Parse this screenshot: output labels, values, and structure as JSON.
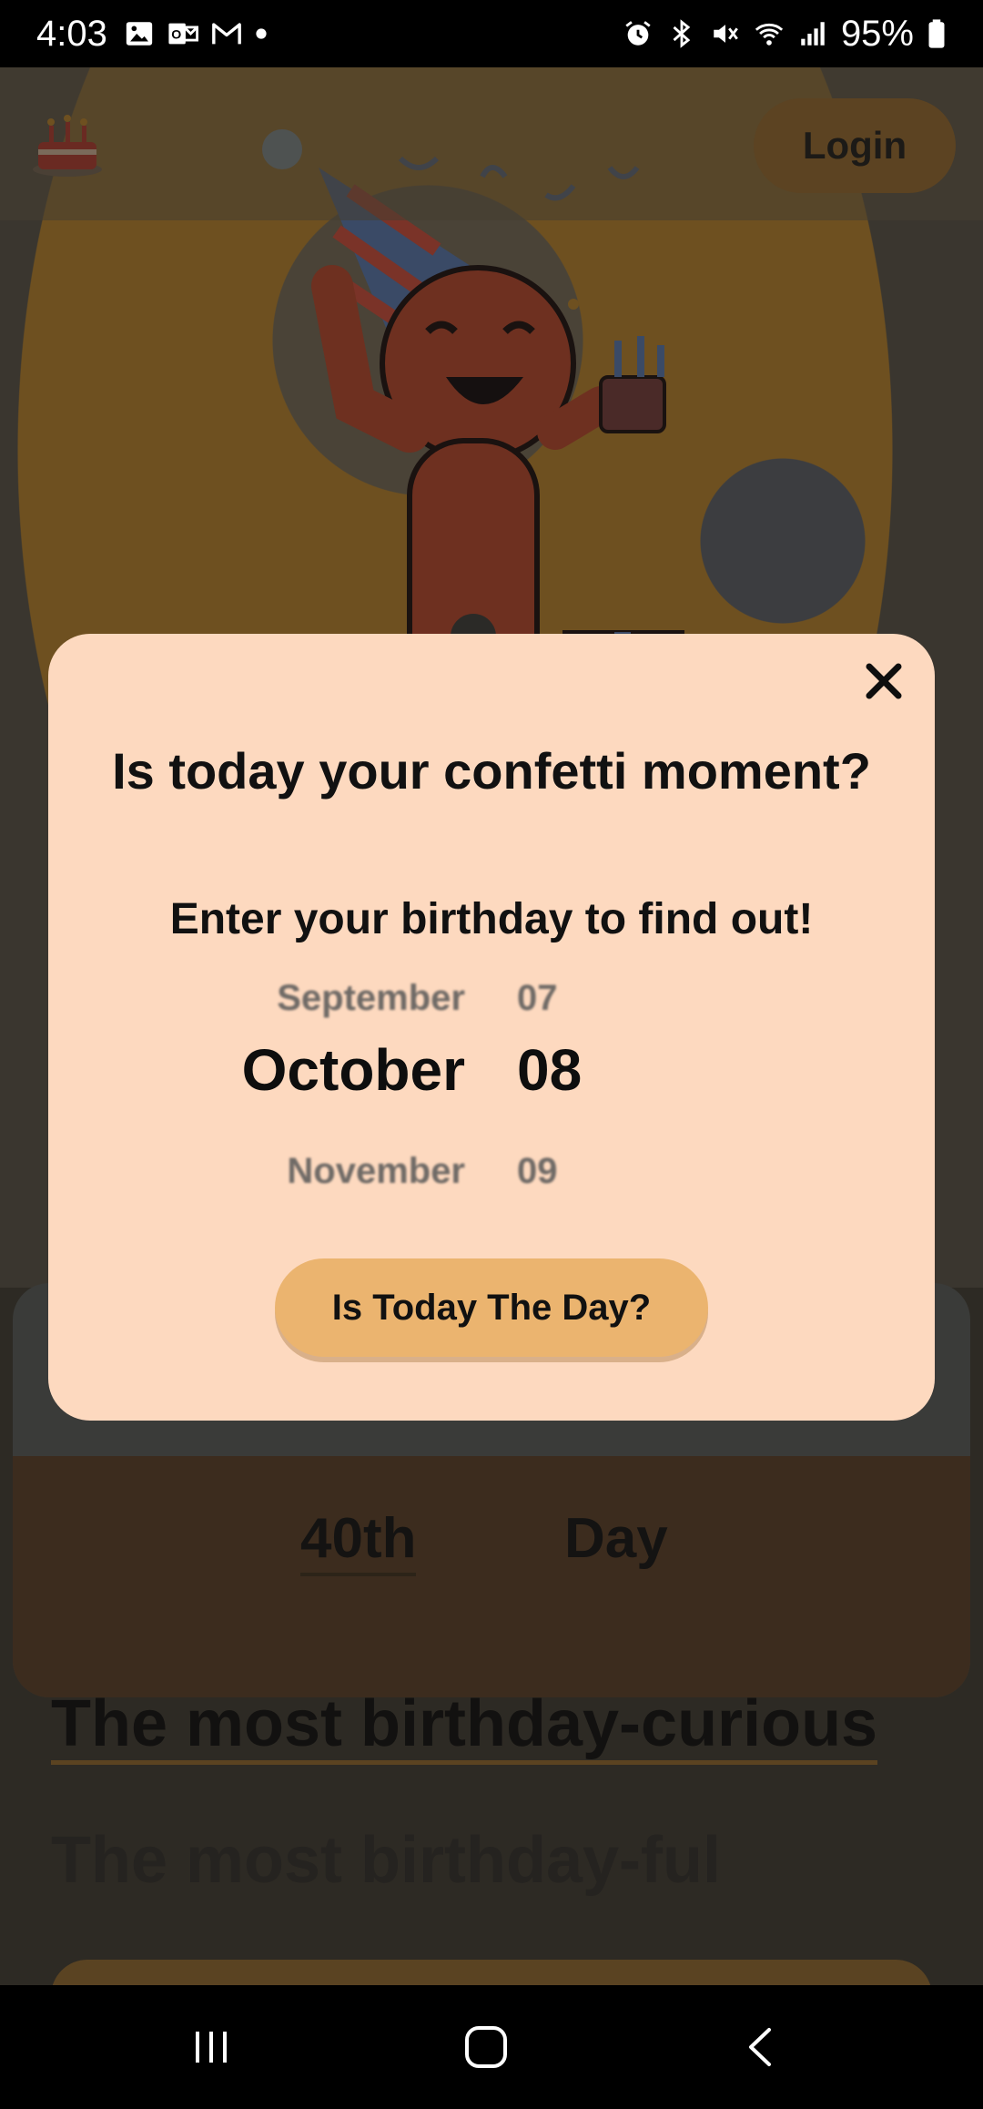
{
  "status_bar": {
    "time": "4:03",
    "battery": "95%",
    "left_icons": [
      "gallery-icon",
      "outlook-icon",
      "gmail-icon",
      "notification-dot-icon"
    ],
    "right_icons": [
      "alarm-icon",
      "bluetooth-icon",
      "mute-icon",
      "wifi-icon",
      "signal-icon",
      "battery-icon"
    ]
  },
  "header": {
    "logo_icon": "birthday-cake-icon",
    "login_label": "Login"
  },
  "counter": {
    "ordinal": "40th",
    "unit": "Day"
  },
  "headlines": {
    "first": "The most birthday-curious",
    "second": "The most birthday-ful"
  },
  "modal": {
    "close_icon": "close-icon",
    "title": "Is today your confetti moment?",
    "subtitle": "Enter your birthday to find out!",
    "picker": {
      "prev_month": "September",
      "selected_month": "October",
      "next_month": "November",
      "prev_day": "07",
      "selected_day": "08",
      "next_day": "09"
    },
    "cta_label": "Is Today The Day?"
  },
  "nav_bar": {
    "recents_icon": "recents-icon",
    "home_icon": "home-icon",
    "back_icon": "back-icon"
  },
  "colors": {
    "modal_bg": "#fdd9bf",
    "cta_bg": "#ebb46f",
    "login_bg_dimmed": "#5c4322",
    "overlay": "rgba(0,0,0,0.6)"
  }
}
